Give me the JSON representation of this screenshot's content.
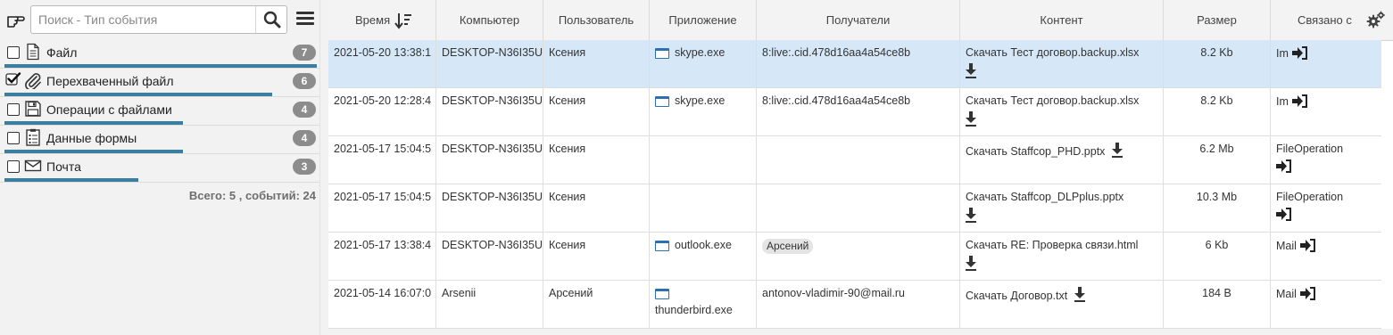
{
  "search": {
    "placeholder": "Поиск - Тип события"
  },
  "categories": [
    {
      "label": "Файл",
      "count": "7",
      "checked": false,
      "icon": "file-icon",
      "fill": 1.0
    },
    {
      "label": "Перехваченный файл",
      "count": "6",
      "checked": true,
      "icon": "paperclip-icon",
      "fill": 0.857
    },
    {
      "label": "Операции с файлами",
      "count": "4",
      "checked": false,
      "icon": "floppy-disk-icon",
      "fill": 0.571
    },
    {
      "label": "Данные формы",
      "count": "4",
      "checked": false,
      "icon": "form-icon",
      "fill": 0.571
    },
    {
      "label": "Почта",
      "count": "3",
      "checked": false,
      "icon": "envelope-icon",
      "fill": 0.429
    }
  ],
  "total": "Всего: 5 , событий: 24",
  "columns": [
    "Время",
    "Компьютер",
    "Пользователь",
    "Приложение",
    "Получатели",
    "Контент",
    "Размер",
    "Связано с"
  ],
  "rows": [
    {
      "time": "2021-05-20 13:38:1",
      "computer": "DESKTOP-N36I35U",
      "user": "Ксения",
      "app": "skype.exe",
      "recipients": "8:live:.cid.478d16aa4a54ce8b",
      "recipient_chip": false,
      "content": "Скачать Тест договор.backup.xlsx",
      "size": "8.2 Kb",
      "related": "Im",
      "selected": true
    },
    {
      "time": "2021-05-20 12:28:4",
      "computer": "DESKTOP-N36I35U",
      "user": "Ксения",
      "app": "skype.exe",
      "recipients": "8:live:.cid.478d16aa4a54ce8b",
      "recipient_chip": false,
      "content": "Скачать Тест договор.backup.xlsx",
      "size": "8.2 Kb",
      "related": "Im",
      "selected": false
    },
    {
      "time": "2021-05-17 15:04:5",
      "computer": "DESKTOP-N36I35U",
      "user": "Ксения",
      "app": "",
      "recipients": "",
      "recipient_chip": false,
      "content": "Скачать Staffcop_PHD.pptx",
      "size": "6.2 Mb",
      "related": "FileOperation",
      "selected": false
    },
    {
      "time": "2021-05-17 15:04:5",
      "computer": "DESKTOP-N36I35U",
      "user": "Ксения",
      "app": "",
      "recipients": "",
      "recipient_chip": false,
      "content": "Скачать Staffcop_DLPplus.pptx",
      "size": "10.3 Mb",
      "related": "FileOperation",
      "selected": false
    },
    {
      "time": "2021-05-17 13:38:4",
      "computer": "DESKTOP-N36I35U",
      "user": "Ксения",
      "app": "outlook.exe",
      "recipients": "Арсений",
      "recipient_chip": true,
      "content": "Скачать RE: Проверка связи.html",
      "size": "6 Kb",
      "related": "Mail",
      "selected": false
    },
    {
      "time": "2021-05-14 16:07:0",
      "computer": "Arsenii",
      "user": "Арсений",
      "app": "thunderbird.exe",
      "recipients": "antonov-vladimir-90@mail.ru",
      "recipient_chip": false,
      "content": "Скачать Договор.txt",
      "size": "184 B",
      "related": "Mail",
      "selected": false
    }
  ],
  "colors": {
    "accent_bar": "#3a7fa0",
    "selected_row": "#d6e8f8",
    "badge": "#8c8c8c"
  }
}
